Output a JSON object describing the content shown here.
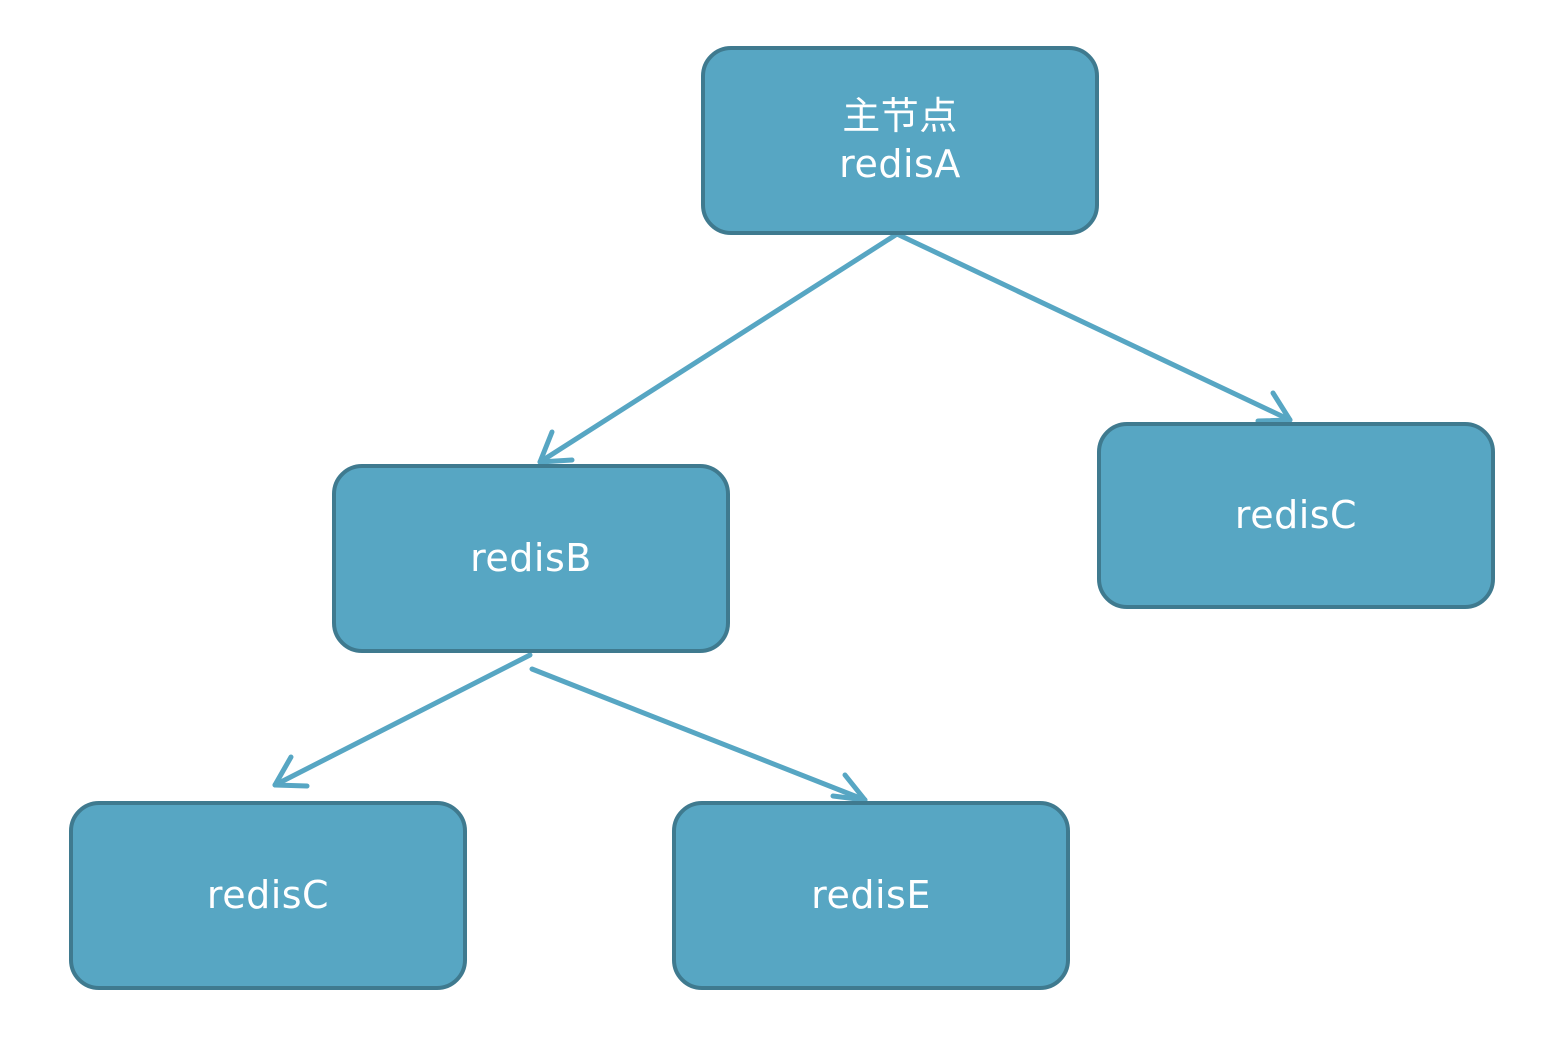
{
  "diagram": {
    "nodes": {
      "a": {
        "line1": "主节点",
        "line2": "redisA"
      },
      "b": {
        "label": "redisB"
      },
      "c1": {
        "label": "redisC"
      },
      "c2": {
        "label": "redisC"
      },
      "e": {
        "label": "redisE"
      }
    },
    "edges": [
      {
        "from": "主节点 redisA",
        "to": "redisB"
      },
      {
        "from": "主节点 redisA",
        "to": "redisC"
      },
      {
        "from": "redisB",
        "to": "redisC"
      },
      {
        "from": "redisB",
        "to": "redisE"
      }
    ],
    "colors": {
      "node_fill": "#57a6c3",
      "node_border": "#3f7a8f",
      "edge": "#57a6c3",
      "text": "#ffffff"
    }
  }
}
